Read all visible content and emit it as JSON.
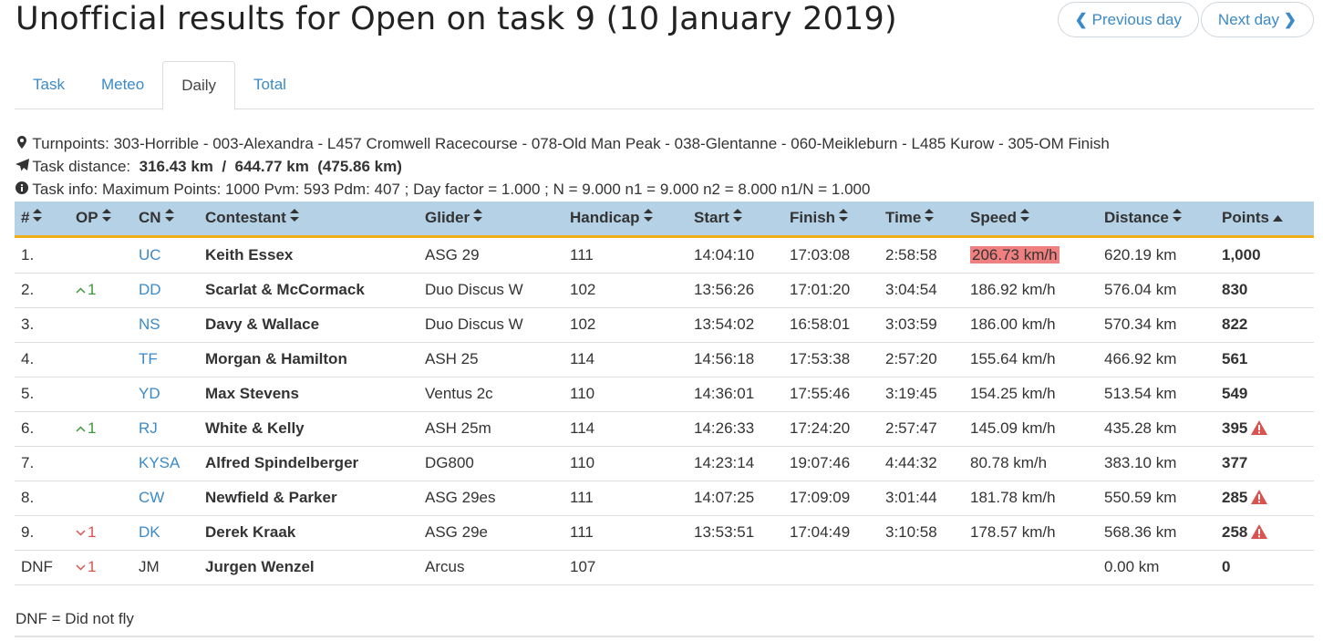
{
  "header": {
    "title": "Unofficial results for Open on task 9 (10 January 2019)",
    "prev_label": "Previous day",
    "next_label": "Next day"
  },
  "tabs": [
    {
      "label": "Task",
      "active": false
    },
    {
      "label": "Meteo",
      "active": false
    },
    {
      "label": "Daily",
      "active": true
    },
    {
      "label": "Total",
      "active": false
    }
  ],
  "task": {
    "turnpoints_label": "Turnpoints:",
    "turnpoints": "303-Horrible - 003-Alexandra - L457 Cromwell Racecourse - 078-Old Man Peak - 038-Glentanne - 060-Meikleburn - L485 Kurow - 305-OM Finish",
    "distance_label": "Task distance:",
    "distance_values": "316.43 km  /  644.77 km  (475.86 km)",
    "info_label": "Task info:",
    "info": "Maximum Points: 1000 Pvm: 593 Pdm: 407 ; Day factor = 1.000 ; N = 9.000 n1 = 9.000 n2 = 8.000 n1/N = 1.000"
  },
  "table": {
    "columns": [
      "#",
      "OP",
      "CN",
      "Contestant",
      "Glider",
      "Handicap",
      "Start",
      "Finish",
      "Time",
      "Speed",
      "Distance",
      "Points"
    ],
    "sorted_column": "Points",
    "rows": [
      {
        "rank": "1.",
        "op": "",
        "op_dir": "",
        "cn": "UC",
        "name": "Keith Essex",
        "glider": "ASG 29",
        "handicap": "111",
        "start": "14:04:10",
        "finish": "17:03:08",
        "time": "2:58:58",
        "speed": "206.73 km/h",
        "speed_highlight": true,
        "distance": "620.19 km",
        "points": "1,000",
        "warning": false
      },
      {
        "rank": "2.",
        "op": "1",
        "op_dir": "up",
        "cn": "DD",
        "name": "Scarlat & McCormack",
        "glider": "Duo Discus W",
        "handicap": "102",
        "start": "13:56:26",
        "finish": "17:01:20",
        "time": "3:04:54",
        "speed": "186.92 km/h",
        "speed_highlight": false,
        "distance": "576.04 km",
        "points": "830",
        "warning": false
      },
      {
        "rank": "3.",
        "op": "",
        "op_dir": "",
        "cn": "NS",
        "name": "Davy & Wallace",
        "glider": "Duo Discus W",
        "handicap": "102",
        "start": "13:54:02",
        "finish": "16:58:01",
        "time": "3:03:59",
        "speed": "186.00 km/h",
        "speed_highlight": false,
        "distance": "570.34 km",
        "points": "822",
        "warning": false
      },
      {
        "rank": "4.",
        "op": "",
        "op_dir": "",
        "cn": "TF",
        "name": "Morgan & Hamilton",
        "glider": "ASH 25",
        "handicap": "114",
        "start": "14:56:18",
        "finish": "17:53:38",
        "time": "2:57:20",
        "speed": "155.64 km/h",
        "speed_highlight": false,
        "distance": "466.92 km",
        "points": "561",
        "warning": false
      },
      {
        "rank": "5.",
        "op": "",
        "op_dir": "",
        "cn": "YD",
        "name": "Max Stevens",
        "glider": "Ventus 2c",
        "handicap": "110",
        "start": "14:36:01",
        "finish": "17:55:46",
        "time": "3:19:45",
        "speed": "154.25 km/h",
        "speed_highlight": false,
        "distance": "513.54 km",
        "points": "549",
        "warning": false
      },
      {
        "rank": "6.",
        "op": "1",
        "op_dir": "up",
        "cn": "RJ",
        "name": "White & Kelly",
        "glider": "ASH 25m",
        "handicap": "114",
        "start": "14:26:33",
        "finish": "17:24:20",
        "time": "2:57:47",
        "speed": "145.09 km/h",
        "speed_highlight": false,
        "distance": "435.28 km",
        "points": "395",
        "warning": true
      },
      {
        "rank": "7.",
        "op": "",
        "op_dir": "",
        "cn": "KYSA",
        "name": "Alfred Spindelberger",
        "glider": "DG800",
        "handicap": "110",
        "start": "14:23:14",
        "finish": "19:07:46",
        "time": "4:44:32",
        "speed": "80.78 km/h",
        "speed_highlight": false,
        "distance": "383.10 km",
        "points": "377",
        "warning": false
      },
      {
        "rank": "8.",
        "op": "",
        "op_dir": "",
        "cn": "CW",
        "name": "Newfield & Parker",
        "glider": "ASG 29es",
        "handicap": "111",
        "start": "14:07:25",
        "finish": "17:09:09",
        "time": "3:01:44",
        "speed": "181.78 km/h",
        "speed_highlight": false,
        "distance": "550.59 km",
        "points": "285",
        "warning": true
      },
      {
        "rank": "9.",
        "op": "1",
        "op_dir": "down",
        "cn": "DK",
        "name": "Derek Kraak",
        "glider": "ASG 29e",
        "handicap": "111",
        "start": "13:53:51",
        "finish": "17:04:49",
        "time": "3:10:58",
        "speed": "178.57 km/h",
        "speed_highlight": false,
        "distance": "568.36 km",
        "points": "258",
        "warning": true
      },
      {
        "rank": "DNF",
        "op": "1",
        "op_dir": "down",
        "cn": "JM",
        "cn_link": false,
        "name": "Jurgen Wenzel",
        "glider": "Arcus",
        "handicap": "107",
        "start": "",
        "finish": "",
        "time": "",
        "speed": "",
        "speed_highlight": false,
        "distance": "0.00 km",
        "points": "0",
        "warning": false
      }
    ]
  },
  "legend": "DNF = Did not fly",
  "colors": {
    "link": "#3b8ac9",
    "header_bg": "#b5d1e6",
    "header_border": "#f0ad1a",
    "up": "#3c9a3c",
    "down": "#d9534f",
    "highlight": "#f08080",
    "warning": "#d9534f"
  },
  "icons": {
    "prev": "chevron-left-icon",
    "next": "chevron-right-icon",
    "turnpoints": "map-marker-icon",
    "distance": "paper-plane-icon",
    "info": "info-circle-icon",
    "sort": "sort-icon",
    "sort_asc": "sort-up-icon",
    "warning": "warning-icon"
  }
}
